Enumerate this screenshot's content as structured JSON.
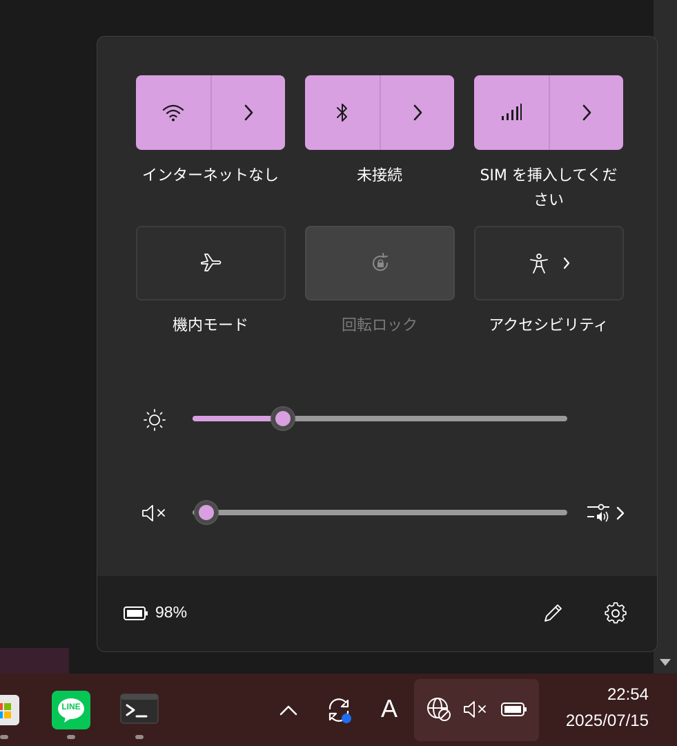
{
  "quick_settings": {
    "tiles": [
      {
        "label": "インターネットなし",
        "icon": "wifi-icon",
        "state": "on"
      },
      {
        "label": "未接続",
        "icon": "bluetooth-icon",
        "state": "on"
      },
      {
        "label": "SIM を挿入してください",
        "label_line1": "SIM を挿入してくだ",
        "label_line2": "さい",
        "icon": "cellular-signal-icon",
        "state": "on"
      },
      {
        "label": "機内モード",
        "icon": "airplane-icon",
        "state": "off"
      },
      {
        "label": "回転ロック",
        "icon": "rotation-lock-icon",
        "state": "disabled"
      },
      {
        "label": "アクセシビリティ",
        "icon": "accessibility-icon",
        "state": "off"
      }
    ],
    "brightness": {
      "icon": "brightness-icon",
      "level": 0.22
    },
    "volume": {
      "icon": "speaker-muted-icon",
      "level": 0.0,
      "mixer_icon": "sound-mixer-icon"
    },
    "battery": {
      "icon": "battery-icon",
      "percent_text": "98%"
    },
    "footer": {
      "edit_icon": "pencil-icon",
      "settings_icon": "gear-icon"
    }
  },
  "taskbar": {
    "apps": [
      {
        "name": "Microsoft Store",
        "icon": "store-icon"
      },
      {
        "name": "LINE",
        "icon": "line-icon",
        "text": "LINE"
      },
      {
        "name": "Terminal",
        "icon": "terminal-icon"
      }
    ],
    "tray": {
      "overflow_icon": "chevron-up-icon",
      "sync_icon": "sync-icon",
      "ime_text": "A",
      "network_icon": "globe-no-internet-icon",
      "volume_icon": "speaker-muted-icon",
      "battery_icon": "battery-icon"
    },
    "clock": {
      "time": "22:54",
      "date": "2025/07/15"
    }
  },
  "colors": {
    "accent": "#d8a0e1",
    "panel": "#2b2b2b",
    "taskbar": "#3a1d1d"
  }
}
